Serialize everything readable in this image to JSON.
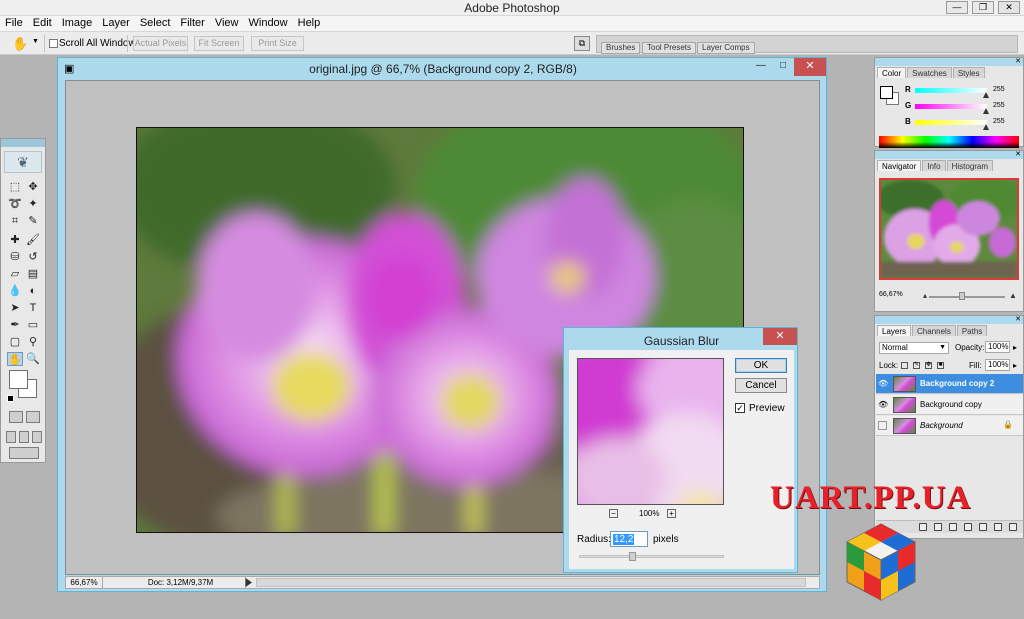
{
  "app": {
    "title": "Adobe Photoshop",
    "minimize_glyph": "—",
    "restore_glyph": "❐",
    "close_glyph": "✕"
  },
  "menu": [
    "File",
    "Edit",
    "Image",
    "Layer",
    "Select",
    "Filter",
    "View",
    "Window",
    "Help"
  ],
  "options_bar": {
    "tool_icon": "hand-icon",
    "scroll_all_windows": "Scroll All Windows",
    "actual_pixels": "Actual Pixels",
    "fit_screen": "Fit Screen",
    "print_size": "Print Size",
    "dock_tabs": [
      "Brushes",
      "Tool Presets",
      "Layer Comps"
    ]
  },
  "document": {
    "title": "original.jpg @ 66,7% (Background copy 2, RGB/8)",
    "zoom": "66,67%",
    "doc_info": "Doc: 3,12M/9,37M"
  },
  "gaussian_blur": {
    "title": "Gaussian Blur",
    "ok": "OK",
    "cancel": "Cancel",
    "preview_label": "Preview",
    "preview_checked": true,
    "zoom_out": "−",
    "zoom_in": "+",
    "zoom_pct": "100%",
    "radius_label": "Radius:",
    "radius_value": "12,2",
    "radius_unit": "pixels"
  },
  "color_panel": {
    "tabs": [
      "Color",
      "Swatches",
      "Styles"
    ],
    "channels": [
      {
        "label": "R",
        "value": "255",
        "color": "#ff3c3c"
      },
      {
        "label": "G",
        "value": "255",
        "color": "#3ccc3c"
      },
      {
        "label": "B",
        "value": "255",
        "color": "#3c3cff"
      }
    ]
  },
  "navigator_panel": {
    "tabs": [
      "Navigator",
      "Info",
      "Histogram"
    ],
    "zoom": "66,67%"
  },
  "layers_panel": {
    "tabs": [
      "Layers",
      "Channels",
      "Paths"
    ],
    "blend_mode": "Normal",
    "opacity_label": "Opacity:",
    "opacity": "100%",
    "lock_label": "Lock:",
    "fill_label": "Fill:",
    "fill": "100%",
    "layers": [
      {
        "name": "Background copy 2",
        "active": true,
        "visible": true
      },
      {
        "name": "Background copy",
        "active": false,
        "visible": true
      },
      {
        "name": "Background",
        "active": false,
        "visible": false,
        "locked": true
      }
    ]
  },
  "watermark": {
    "text": "UART.PP.UA"
  },
  "colors": {
    "window_frame": "#acd9ec",
    "close_red": "#c75050",
    "selection_blue": "#3d8ee0",
    "watermark_red": "#e8202a"
  }
}
